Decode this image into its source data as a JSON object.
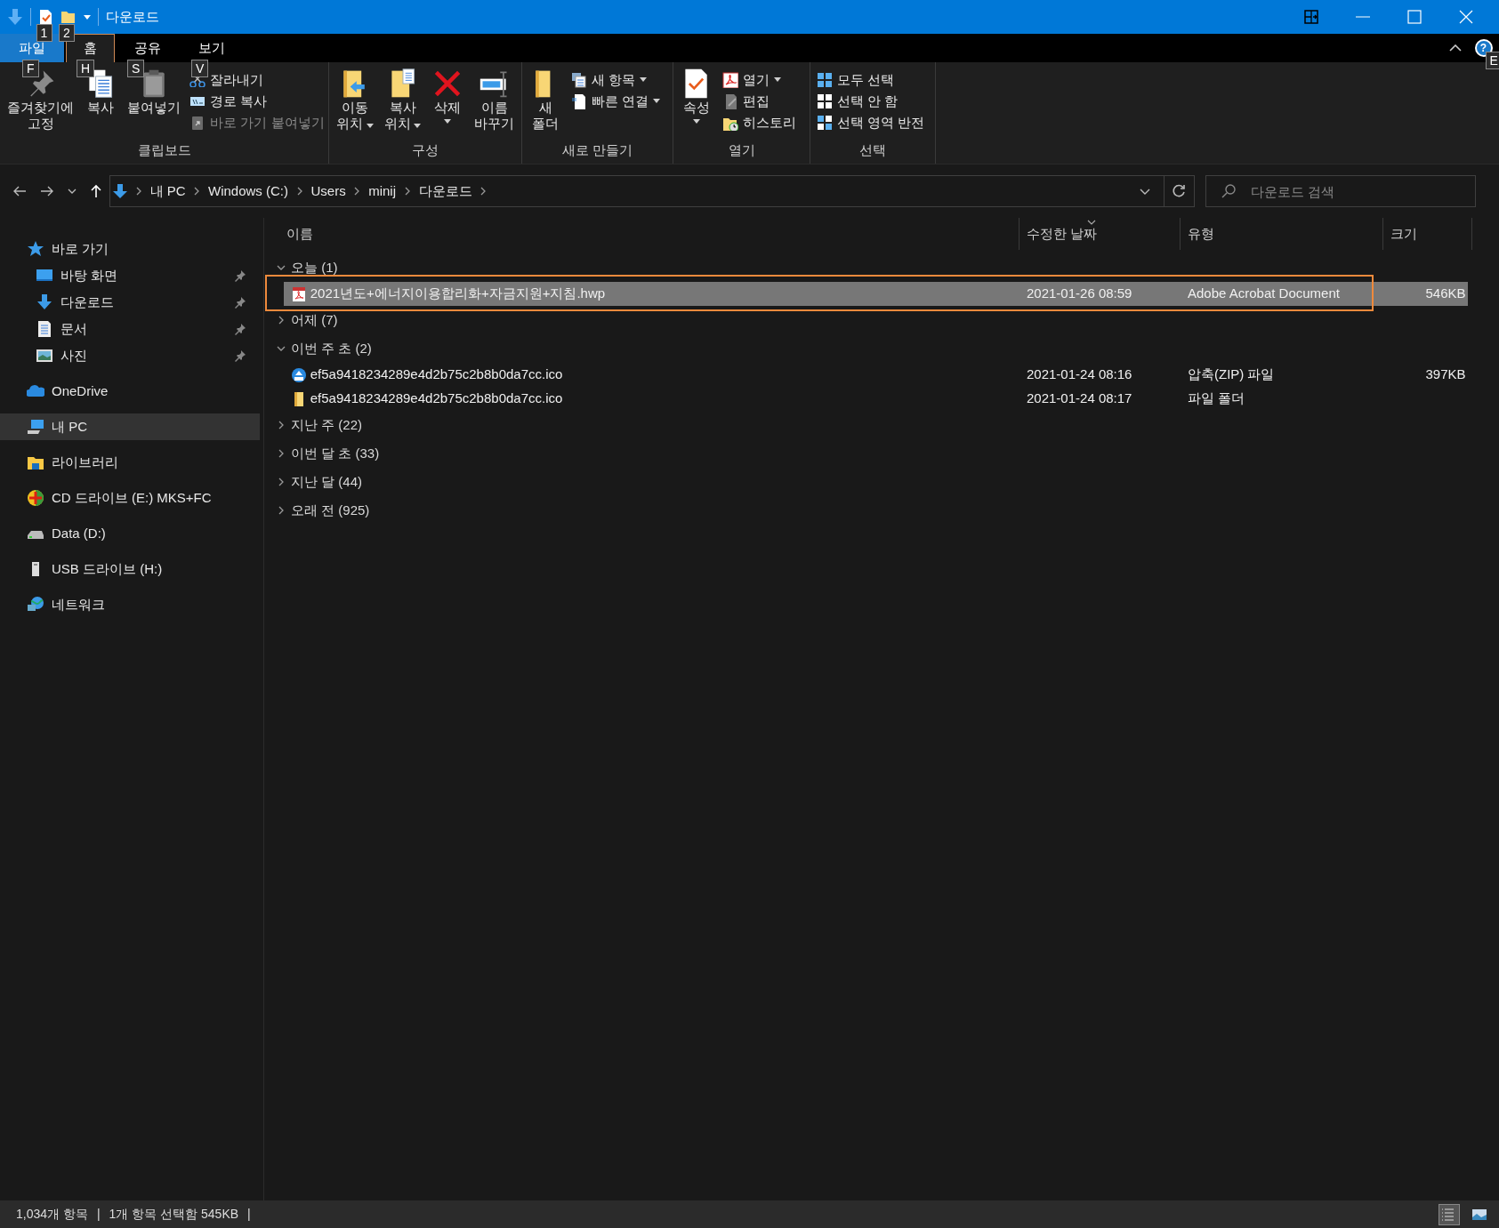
{
  "window": {
    "title": "다운로드",
    "quick_access": [
      {
        "kind": "properties",
        "keytip": "1"
      },
      {
        "kind": "folder",
        "keytip": "2"
      }
    ]
  },
  "ribbon_tabs": [
    {
      "label": "파일",
      "kind": "file",
      "keytip": "F",
      "selected": false
    },
    {
      "label": "홈",
      "kind": "tab",
      "keytip": "H",
      "selected": true
    },
    {
      "label": "공유",
      "kind": "tab",
      "keytip": "S",
      "selected": false
    },
    {
      "label": "보기",
      "kind": "tab",
      "keytip": "V",
      "selected": false
    }
  ],
  "help": {
    "label": "?",
    "keytip": "E"
  },
  "ribbon_groups": [
    {
      "label": "클립보드",
      "columns": [
        [
          {
            "kind": "large",
            "label": "즐겨찾기에 고정"
          }
        ],
        [
          {
            "kind": "large",
            "label": "복사"
          }
        ],
        [
          {
            "kind": "large",
            "label": "붙여넣기"
          }
        ],
        [
          {
            "kind": "small",
            "label": "잘라내기"
          },
          {
            "kind": "small",
            "label": "경로 복사"
          },
          {
            "kind": "small",
            "label": "바로 가기 붙여넣기",
            "disabled": true
          }
        ]
      ]
    },
    {
      "label": "구성",
      "columns": [
        [
          {
            "kind": "large",
            "label": "이동 위치",
            "dropdown": true
          }
        ],
        [
          {
            "kind": "large",
            "label": "복사 위치",
            "dropdown": true
          }
        ],
        [
          {
            "kind": "tall",
            "label": "삭제",
            "dropdown": true
          }
        ],
        [
          {
            "kind": "large",
            "label": "이름 바꾸기"
          }
        ]
      ]
    },
    {
      "label": "새로 만들기",
      "columns": [
        [
          {
            "kind": "large",
            "label": "새 폴더"
          }
        ],
        [
          {
            "kind": "small",
            "label": "새 항목",
            "dropdown": true
          },
          {
            "kind": "small",
            "label": "빠른 연결",
            "dropdown": true
          }
        ]
      ]
    },
    {
      "label": "열기",
      "columns": [
        [
          {
            "kind": "tall",
            "label": "속성",
            "dropdown": true
          }
        ],
        [
          {
            "kind": "small",
            "label": "열기",
            "dropdown": true
          },
          {
            "kind": "small",
            "label": "편집"
          },
          {
            "kind": "small",
            "label": "히스토리"
          }
        ]
      ]
    },
    {
      "label": "선택",
      "columns": [
        [
          {
            "kind": "small",
            "label": "모두 선택"
          },
          {
            "kind": "small",
            "label": "선택 안 함"
          },
          {
            "kind": "small",
            "label": "선택 영역 반전"
          }
        ]
      ]
    }
  ],
  "address": {
    "crumbs": [
      "내 PC",
      "Windows (C:)",
      "Users",
      "minij",
      "다운로드"
    ]
  },
  "search": {
    "placeholder": "다운로드 검색"
  },
  "navigation": [
    {
      "label": "바로 가기",
      "kind": "star",
      "selected": false,
      "children": [
        {
          "label": "바탕 화면",
          "kind": "desktop",
          "pinned": true,
          "selected": false
        },
        {
          "label": "다운로드",
          "kind": "download",
          "pinned": true,
          "selected": false
        },
        {
          "label": "문서",
          "kind": "document",
          "pinned": true,
          "selected": false
        },
        {
          "label": "사진",
          "kind": "image",
          "pinned": true,
          "selected": false
        }
      ]
    },
    {
      "label": "OneDrive",
      "kind": "cloud",
      "selected": false
    },
    {
      "label": "내 PC",
      "kind": "pc",
      "selected": true
    },
    {
      "label": "라이브러리",
      "kind": "library",
      "selected": false
    },
    {
      "label": "CD 드라이브 (E:) MKS+FC",
      "kind": "cd",
      "selected": false
    },
    {
      "label": "Data (D:)",
      "kind": "drive",
      "selected": false
    },
    {
      "label": "USB 드라이브 (H:)",
      "kind": "usb",
      "selected": false
    },
    {
      "label": "네트워크",
      "kind": "network",
      "selected": false
    }
  ],
  "columns": [
    {
      "label": "이름",
      "sorted": false
    },
    {
      "label": "수정한 날짜",
      "sorted": true
    },
    {
      "label": "유형",
      "sorted": false
    },
    {
      "label": "크기",
      "sorted": false
    }
  ],
  "groups": [
    {
      "label": "오늘 (1)",
      "expanded": true,
      "items": [
        {
          "name": "2021년도+에너지이용합리화+자금지원+지침.hwp",
          "kind": "pdf",
          "date": "2021-01-26 08:59",
          "type": "Adobe Acrobat Document",
          "size": "546KB",
          "selected": true,
          "highlighted": true
        }
      ]
    },
    {
      "label": "어제 (7)",
      "expanded": false
    },
    {
      "label": "이번 주 초 (2)",
      "expanded": true,
      "items": [
        {
          "name": "ef5a9418234289e4d2b75c2b8b0da7cc.ico",
          "kind": "zip",
          "date": "2021-01-24 08:16",
          "type": "압축(ZIP) 파일",
          "size": "397KB",
          "selected": false,
          "highlighted": false
        },
        {
          "name": "ef5a9418234289e4d2b75c2b8b0da7cc.ico",
          "kind": "folder",
          "date": "2021-01-24 08:17",
          "type": "파일 폴더",
          "selected": false,
          "highlighted": false
        }
      ]
    },
    {
      "label": "지난 주 (22)",
      "expanded": false
    },
    {
      "label": "이번 달 초 (33)",
      "expanded": false
    },
    {
      "label": "지난 달 (44)",
      "expanded": false
    },
    {
      "label": "오래 전 (925)",
      "expanded": false
    }
  ],
  "status_bar": {
    "texts": [
      "1,034개 항목",
      "|",
      "1개 항목 선택함 545KB",
      "|"
    ],
    "views": [
      {
        "kind": "details",
        "selected": true
      },
      {
        "kind": "tiles",
        "selected": false
      }
    ]
  }
}
